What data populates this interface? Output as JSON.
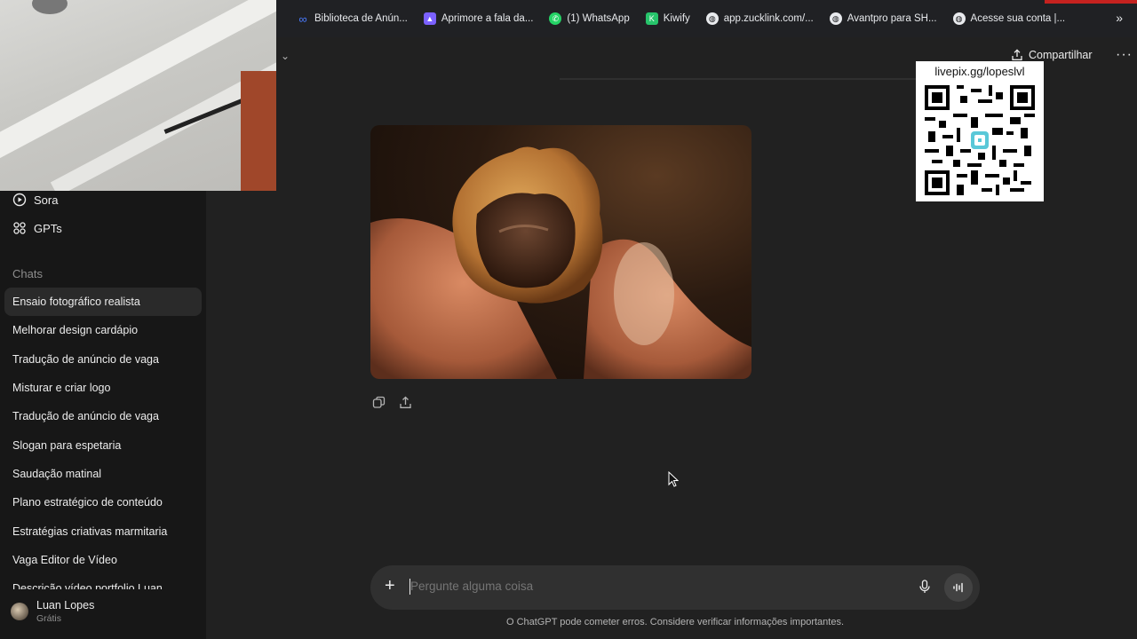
{
  "bookmarks": [
    {
      "label": "Biblioteca de Anún...",
      "icon": "meta-icon",
      "color": "#1877f2"
    },
    {
      "label": "Aprimore a fala da...",
      "icon": "app-icon",
      "color": "#7b61ff"
    },
    {
      "label": "(1) WhatsApp",
      "icon": "whatsapp-icon",
      "color": "#25d366"
    },
    {
      "label": "Kiwify",
      "icon": "kiwify-icon",
      "color": "#27c46b"
    },
    {
      "label": "app.zucklink.com/...",
      "icon": "globe-icon",
      "color": "#5f6368"
    },
    {
      "label": "Avantpro para SH...",
      "icon": "globe-icon",
      "color": "#5f6368"
    },
    {
      "label": "Acesse sua conta |...",
      "icon": "globe-icon",
      "color": "#5f6368"
    }
  ],
  "sidebar": {
    "nav": [
      {
        "label": "Sora",
        "icon": "play-circle-icon"
      },
      {
        "label": "GPTs",
        "icon": "grid-icon"
      }
    ],
    "section_label": "Chats",
    "chats": [
      "Ensaio fotográfico realista",
      "Melhorar design cardápio",
      "Tradução de anúncio de vaga",
      "Misturar e criar logo",
      "Tradução de anúncio de vaga",
      "Slogan para espetaria",
      "Saudação matinal",
      "Plano estratégico de conteúdo",
      "Estratégias criativas marmitaria",
      "Vaga Editor de Vídeo",
      "Descrição vídeo portfolio Luan"
    ],
    "active_chat": 0,
    "user": {
      "name": "Luan Lopes",
      "plan": "Grátis"
    }
  },
  "header": {
    "share_label": "Compartilhar",
    "more_label": "···"
  },
  "overlay": {
    "qr_label": "livepix.gg/lopeslvl"
  },
  "composer": {
    "placeholder": "Pergunte alguma coisa",
    "plus": "+"
  },
  "disclaimer": "O ChatGPT pode cometer erros. Considere verificar informações importantes.",
  "colors": {
    "background": "#212121",
    "sidebar": "#171717",
    "composer": "#303030",
    "accent_red": "#c5221f"
  }
}
